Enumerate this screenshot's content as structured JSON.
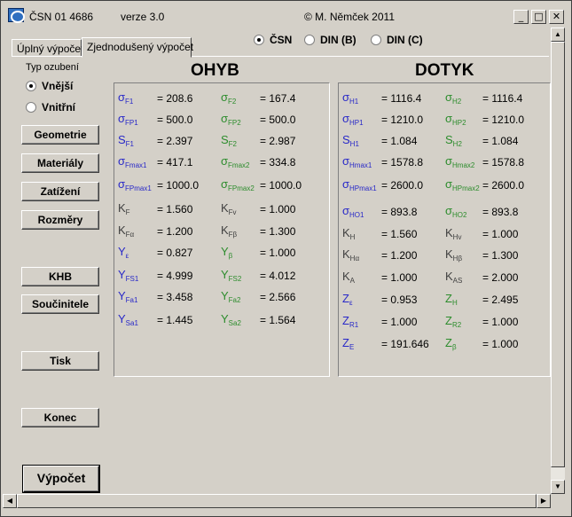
{
  "titlebar": {
    "title": "ČSN 01 4686",
    "version": "verze 3.0",
    "author": "©  M. Němček  2011",
    "buttons": {
      "minimize": "_",
      "maximize": "□",
      "close": "✕"
    }
  },
  "tabs": [
    {
      "label": "Úplný výpočet"
    },
    {
      "label": "Zjednodušený výpočet"
    }
  ],
  "standards": [
    {
      "label": "ČSN",
      "selected": true
    },
    {
      "label": "DIN (B)",
      "selected": false
    },
    {
      "label": "DIN (C)",
      "selected": false
    }
  ],
  "typ": {
    "label": "Typ ozubení",
    "options": [
      {
        "label": "Vnější",
        "selected": true
      },
      {
        "label": "Vnitřní",
        "selected": false
      }
    ]
  },
  "buttons": {
    "geometrie": "Geometrie",
    "materialy": "Materiály",
    "zatizeni": "Zatížení",
    "rozmery": "Rozměry",
    "khb": "KHB",
    "soucinitele": "Součinitele",
    "tisk": "Tisk",
    "konec": "Konec",
    "vypocet": "Výpočet"
  },
  "ohyb": {
    "heading": "OHYB",
    "rows": [
      {
        "s1": "σ",
        "b1": "F1",
        "v1": "208.6",
        "s2": "σ",
        "b2": "F2",
        "v2": "167.4"
      },
      {
        "s1": "σ",
        "b1": "FP1",
        "v1": "500.0",
        "s2": "σ",
        "b2": "FP2",
        "v2": "500.0"
      },
      {
        "s1": "S",
        "b1": "F1",
        "v1": "2.397",
        "s2": "S",
        "b2": "F2",
        "v2": "2.987"
      },
      {
        "s1": "σ",
        "b1": "Fmax1",
        "v1": "417.1",
        "s2": "σ",
        "b2": "Fmax2",
        "v2": "334.8"
      },
      {
        "s1": "σ",
        "b1": "FPmax1",
        "v1": "1000.0",
        "s2": "σ",
        "b2": "FPmax2",
        "v2": "1000.0"
      },
      {
        "s1": "K",
        "b1": "F",
        "v1": "1.560",
        "s2": "K",
        "b2": "Fv",
        "v2": "1.000"
      },
      {
        "s1": "K",
        "b1": "Fα",
        "v1": "1.200",
        "s2": "K",
        "b2": "Fβ",
        "v2": "1.300"
      },
      {
        "s1": "Y",
        "b1": "ε",
        "v1": "0.827",
        "s2": "Y",
        "b2": "β",
        "v2": "1.000"
      },
      {
        "s1": "Y",
        "b1": "FS1",
        "v1": "4.999",
        "s2": "Y",
        "b2": "FS2",
        "v2": "4.012"
      },
      {
        "s1": "Y",
        "b1": "Fa1",
        "v1": "3.458",
        "s2": "Y",
        "b2": "Fa2",
        "v2": "2.566"
      },
      {
        "s1": "Y",
        "b1": "Sa1",
        "v1": "1.445",
        "s2": "Y",
        "b2": "Sa2",
        "v2": "1.564"
      }
    ]
  },
  "dotyk": {
    "heading": "DOTYK",
    "rows": [
      {
        "s1": "σ",
        "b1": "H1",
        "v1": "1116.4",
        "s2": "σ",
        "b2": "H2",
        "v2": "1116.4"
      },
      {
        "s1": "σ",
        "b1": "HP1",
        "v1": "1210.0",
        "s2": "σ",
        "b2": "HP2",
        "v2": "1210.0"
      },
      {
        "s1": "S",
        "b1": "H1",
        "v1": "1.084",
        "s2": "S",
        "b2": "H2",
        "v2": "1.084"
      },
      {
        "s1": "σ",
        "b1": "Hmax1",
        "v1": "1578.8",
        "s2": "σ",
        "b2": "Hmax2",
        "v2": "1578.8"
      },
      {
        "s1": "σ",
        "b1": "HPmax1",
        "v1": "2600.0",
        "s2": "σ",
        "b2": "HPmax2",
        "v2": "2600.0"
      },
      {
        "s1": "σ",
        "b1": "HO1",
        "v1": "893.8",
        "s2": "σ",
        "b2": "HO2",
        "v2": "893.8"
      },
      {
        "s1": "K",
        "b1": "H",
        "v1": "1.560",
        "s2": "K",
        "b2": "Hv",
        "v2": "1.000"
      },
      {
        "s1": "K",
        "b1": "Hα",
        "v1": "1.200",
        "s2": "K",
        "b2": "Hβ",
        "v2": "1.300"
      },
      {
        "s1": "K",
        "b1": "A",
        "v1": "1.000",
        "s2": "K",
        "b2": "AS",
        "v2": "2.000"
      },
      {
        "s1": "Z",
        "b1": "ε",
        "v1": "0.953",
        "s2": "Z",
        "b2": "H",
        "v2": "2.495"
      },
      {
        "s1": "Z",
        "b1": "R1",
        "v1": "1.000",
        "s2": "Z",
        "b2": "R2",
        "v2": "1.000"
      },
      {
        "s1": "Z",
        "b1": "E",
        "v1": "191.646",
        "s2": "Z",
        "b2": "β",
        "v2": "1.000"
      }
    ]
  },
  "colors": {
    "label_col1": "#2828c8",
    "label_col2": "#2c8c2c",
    "k_labels": "#404040"
  }
}
